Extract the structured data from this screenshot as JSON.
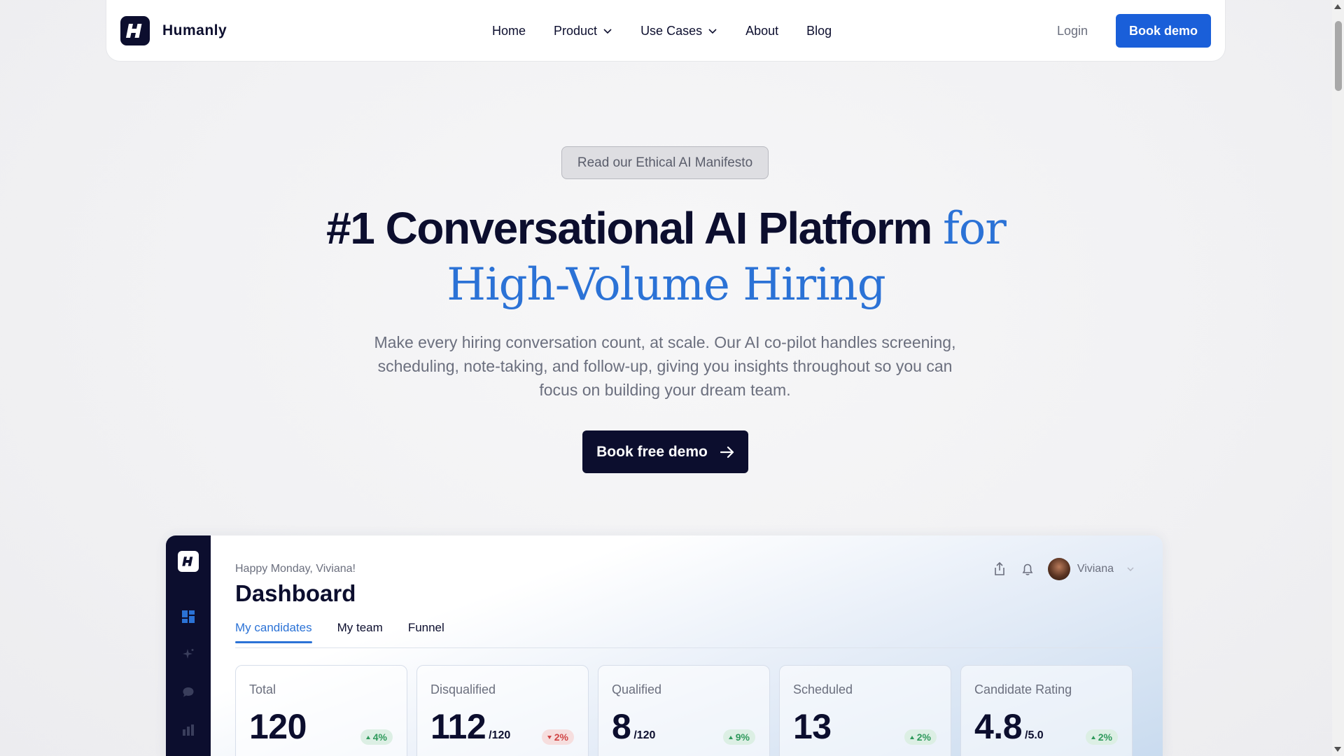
{
  "brand": {
    "name": "Humanly",
    "logo_letter": "H"
  },
  "nav": {
    "links": [
      {
        "label": "Home",
        "has_dropdown": false
      },
      {
        "label": "Product",
        "has_dropdown": true
      },
      {
        "label": "Use Cases",
        "has_dropdown": true
      },
      {
        "label": "About",
        "has_dropdown": false
      },
      {
        "label": "Blog",
        "has_dropdown": false
      }
    ],
    "login": "Login",
    "cta": "Book demo"
  },
  "hero": {
    "pill": "Read our Ethical AI Manifesto",
    "headline_main": "#1 Conversational AI Platform",
    "headline_accent_1": "for",
    "headline_accent_2": "High-Volume Hiring",
    "subtitle": "Make every hiring conversation count, at scale. Our AI co-pilot handles screening, scheduling, note-taking, and follow-up, giving you insights throughout so you can focus on building your dream team.",
    "cta": "Book free demo"
  },
  "dashboard": {
    "greeting": "Happy Monday, Viviana!",
    "title": "Dashboard",
    "user": "Viviana",
    "tabs": [
      "My candidates",
      "My team",
      "Funnel"
    ],
    "active_tab": "My candidates",
    "cards": [
      {
        "label": "Total",
        "value": "120",
        "unit": "",
        "change": "4%",
        "direction": "up"
      },
      {
        "label": "Disqualified",
        "value": "112",
        "unit": "/120",
        "change": "2%",
        "direction": "down"
      },
      {
        "label": "Qualified",
        "value": "8",
        "unit": "/120",
        "change": "9%",
        "direction": "up"
      },
      {
        "label": "Scheduled",
        "value": "13",
        "unit": "",
        "change": "2%",
        "direction": "up"
      },
      {
        "label": "Candidate Rating",
        "value": "4.8",
        "unit": "/5.0",
        "change": "2%",
        "direction": "up"
      }
    ]
  },
  "colors": {
    "navy": "#0c0e2e",
    "blue": "#1a5fd9",
    "accent_blue": "#2b72d6",
    "positive": "#2f9a5c",
    "negative": "#d04545"
  }
}
